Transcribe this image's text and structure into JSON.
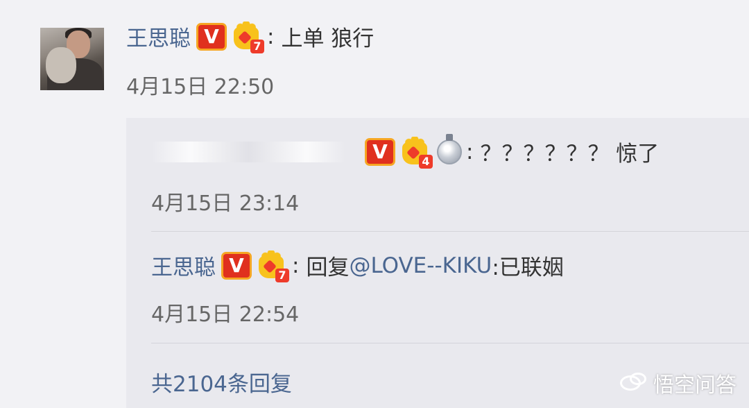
{
  "comment": {
    "author": "王思聪",
    "text": "上单 狼行",
    "time": "4月15日 22:50",
    "badges": {
      "verified": "V",
      "fan_level": "7"
    }
  },
  "replies": [
    {
      "author_hidden": true,
      "text": "？？？？？？ 惊了",
      "time": "4月15日 23:14",
      "badges": {
        "verified": "V",
        "fan_level": "4",
        "medal": "silver-medal-icon"
      }
    },
    {
      "author": "王思聪",
      "reply_prefix": "回复",
      "mention": "@LOVE--KIKU",
      "text": ":已联姻",
      "time": "4月15日 22:54",
      "badges": {
        "verified": "V",
        "fan_level": "7"
      }
    }
  ],
  "footer": {
    "more_replies": "共2104条回复"
  },
  "watermark": {
    "text": "悟空问答"
  },
  "colors": {
    "name_link": "#4a6690",
    "panel_bg": "#e9e9ee",
    "page_bg": "#f2f2f5",
    "badge_red": "#e0301e",
    "crown_gold": "#f8c21c"
  }
}
